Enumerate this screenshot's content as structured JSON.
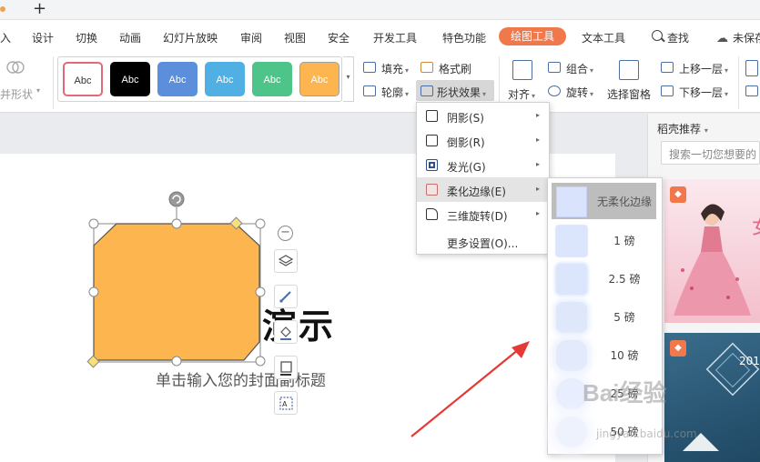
{
  "colors": {
    "accent": "#f0784b",
    "shape_fill": "#fdb64f",
    "shape_stroke": "#555555",
    "arrow": "#e53935",
    "icon_blue": "#4a6fa5"
  },
  "tabstrip": {
    "new_tab": "+"
  },
  "menu": {
    "items": [
      {
        "label": "入"
      },
      {
        "label": "设计"
      },
      {
        "label": "切换"
      },
      {
        "label": "动画"
      },
      {
        "label": "幻灯片放映"
      },
      {
        "label": "审阅"
      },
      {
        "label": "视图"
      },
      {
        "label": "安全"
      },
      {
        "label": "开发工具"
      },
      {
        "label": "特色功能"
      },
      {
        "label": "绘图工具"
      },
      {
        "label": "文本工具"
      },
      {
        "label": "查找"
      },
      {
        "label": "未保存"
      }
    ]
  },
  "ribbon": {
    "merge_shape": "并形状",
    "style_swatches": [
      {
        "label": "Abc",
        "bg": "#ffffff",
        "fg": "#333333",
        "border": "#e06a7a"
      },
      {
        "label": "Abc",
        "bg": "#000000",
        "fg": "#ffffff",
        "border": "#000000"
      },
      {
        "label": "Abc",
        "bg": "#5b8fdc",
        "fg": "#ffffff",
        "border": "#5b8fdc"
      },
      {
        "label": "Abc",
        "bg": "#51b0e3",
        "fg": "#ffffff",
        "border": "#51b0e3"
      },
      {
        "label": "Abc",
        "bg": "#4fc48a",
        "fg": "#ffffff",
        "border": "#4fc48a"
      },
      {
        "label": "Abc",
        "bg": "#fdb64f",
        "fg": "#ffffff",
        "border": "#9e9e9e"
      }
    ],
    "fill": "填充",
    "outline": "轮廓",
    "format_painter": "格式刷",
    "shape_effects": "形状效果",
    "align": "对齐",
    "group": "组合",
    "rotate": "旋转",
    "selection_pane": "选择窗格",
    "bring_forward": "上移一层",
    "send_backward": "下移一层"
  },
  "slide": {
    "title": "演示",
    "subtitle": "单击输入您的封面副标题"
  },
  "right_pane": {
    "title": "稻壳推荐",
    "search_placeholder": "搜索一切您想要的",
    "badge": "◆"
  },
  "effects_menu": {
    "items": [
      {
        "label": "阴影(S)",
        "icon": "shadow-icon",
        "has_submenu": true
      },
      {
        "label": "倒影(R)",
        "icon": "reflection-icon",
        "has_submenu": true
      },
      {
        "label": "发光(G)",
        "icon": "glow-icon",
        "has_submenu": true
      },
      {
        "label": "柔化边缘(E)",
        "icon": "soft-edge-icon",
        "has_submenu": true,
        "highlighted": true
      },
      {
        "label": "三维旋转(D)",
        "icon": "3d-rotation-icon",
        "has_submenu": true
      },
      {
        "label": "更多设置(O)...",
        "has_submenu": false
      }
    ]
  },
  "soft_edge_submenu": {
    "items": [
      {
        "label": "无柔化边缘",
        "selected": true
      },
      {
        "label": "1 磅"
      },
      {
        "label": "2.5 磅"
      },
      {
        "label": "5 磅"
      },
      {
        "label": "10 磅"
      },
      {
        "label": "25 磅"
      },
      {
        "label": "50 磅"
      }
    ]
  },
  "watermark": {
    "brand": "Bai经验",
    "url": "jingyan.baidu.com"
  }
}
